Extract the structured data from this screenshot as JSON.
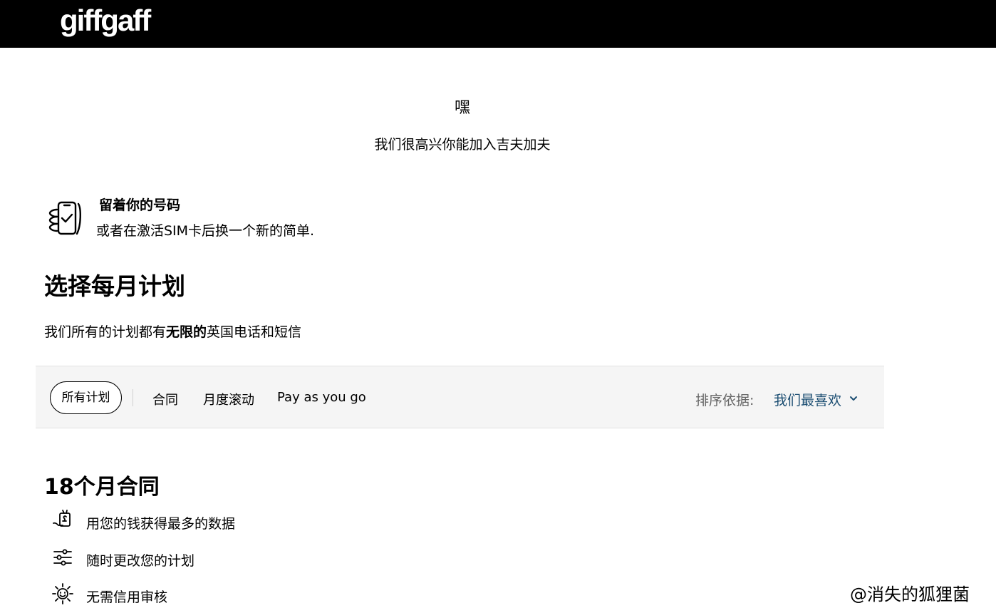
{
  "header": {
    "logo": "giffgaff"
  },
  "greeting": {
    "title": "嘿",
    "subtitle": "我们很高兴你能加入吉夫加夫"
  },
  "keep_number": {
    "icon": "phone-check-icon",
    "title": "留着你的号码",
    "description": "或者在激活SIM卡后换一个新的简单."
  },
  "plans": {
    "heading": "选择每月计划",
    "desc_prefix": "我们所有的计划都有",
    "desc_bold": "无限的",
    "desc_suffix": "英国电话和短信"
  },
  "filters": {
    "tabs": [
      "所有计划",
      "合同",
      "月度滚动",
      "Pay as you go"
    ],
    "selected": "所有计划",
    "sort_label": "排序依据:",
    "sort_value": "我们最喜欢",
    "sort_color": "#1d4f73"
  },
  "contract": {
    "heading": "18个月合同",
    "features": [
      {
        "icon": "money-hand-icon",
        "text": "用您的钱获得最多的数据"
      },
      {
        "icon": "sliders-icon",
        "text": "随时更改您的计划"
      },
      {
        "icon": "sun-icon",
        "text": "无需信用审核"
      }
    ]
  },
  "watermark": "@消失的狐狸菌"
}
